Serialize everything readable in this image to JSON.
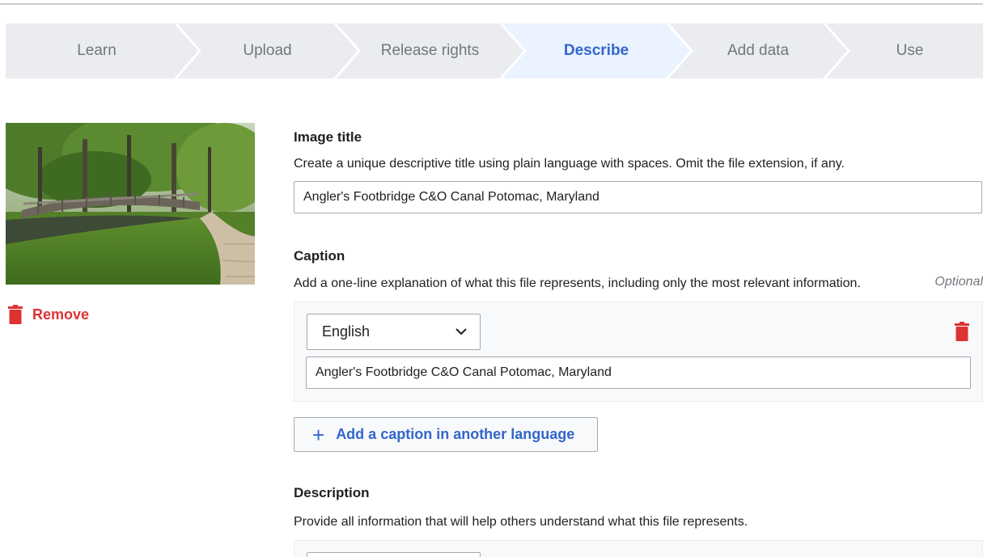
{
  "steps": [
    {
      "label": "Learn"
    },
    {
      "label": "Upload"
    },
    {
      "label": "Release rights"
    },
    {
      "label": "Describe",
      "active": true
    },
    {
      "label": "Add data"
    },
    {
      "label": "Use"
    }
  ],
  "thumbnail": {
    "icon": "photo-thumbnail-footbridge"
  },
  "remove": {
    "label": "Remove",
    "icon": "trash-icon"
  },
  "image_title": {
    "heading": "Image title",
    "help": "Create a unique descriptive title using plain language with spaces. Omit the file extension, if any.",
    "value": "Angler's Footbridge C&O Canal Potomac, Maryland"
  },
  "caption": {
    "heading": "Caption",
    "help": "Add a one-line explanation of what this file represents, including only the most relevant information.",
    "optional": "Optional",
    "language": "English",
    "value": "Angler's Footbridge C&O Canal Potomac, Maryland",
    "add_button": "Add a caption in another language"
  },
  "description": {
    "heading": "Description",
    "help": "Provide all information that will help others understand what this file represents."
  },
  "colors": {
    "accent": "#3366cc",
    "destructive": "#dd3333",
    "steps_bg": "#eaecf0",
    "active_step_bg": "#eaf3ff"
  }
}
